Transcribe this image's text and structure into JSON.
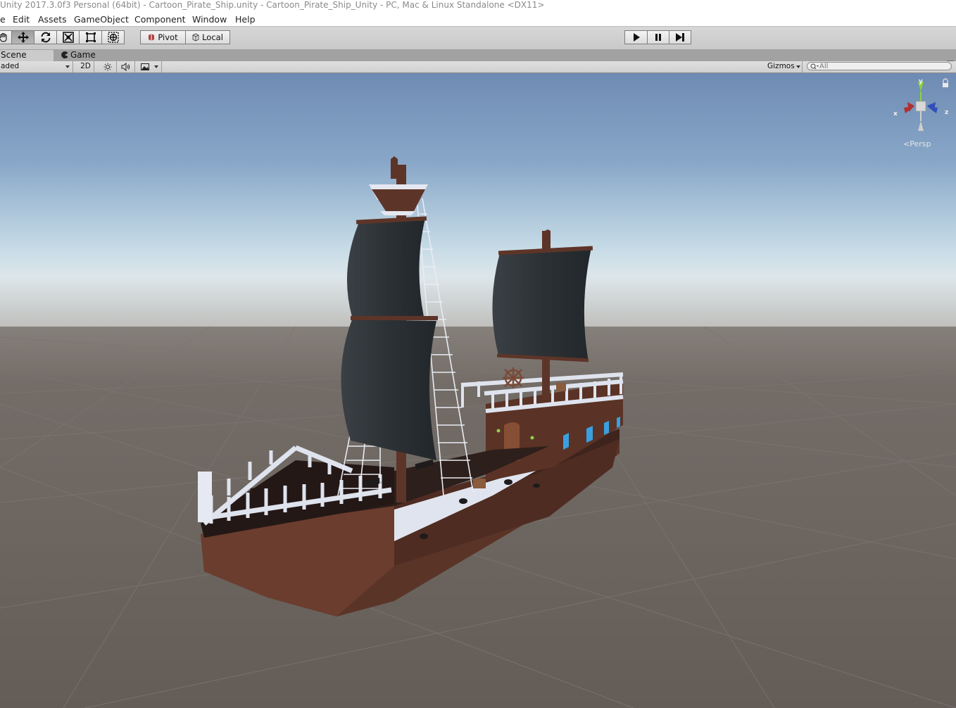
{
  "window": {
    "title": "Unity 2017.3.0f3 Personal (64bit) - Cartoon_Pirate_Ship.unity - Cartoon_Pirate_Ship_Unity - PC, Mac & Linux Standalone <DX11>"
  },
  "menu": {
    "file": "e",
    "edit": "Edit",
    "assets": "Assets",
    "gameobject": "GameObject",
    "component": "Component",
    "window": "Window",
    "help": "Help"
  },
  "toolbar": {
    "tools": [
      "hand-icon",
      "move-icon",
      "rotate-icon",
      "scale-icon",
      "rect-icon",
      "transform-icon"
    ],
    "active_tool": "move-icon",
    "pivot_label": "Pivot",
    "local_label": "Local",
    "playback": [
      "play-icon",
      "pause-icon",
      "step-icon"
    ]
  },
  "tabs": {
    "scene": "Scene",
    "game": "Game"
  },
  "scene_toolbar": {
    "shading_mode": "aded",
    "mode_2d": "2D",
    "gizmos_label": "Gizmos",
    "search_placeholder": "All"
  },
  "viewport": {
    "projection_label": "Persp",
    "axis_labels": {
      "x": "x",
      "y": "y",
      "z": "z"
    },
    "colors": {
      "sky_top": "#6f8fb6",
      "horizon": "#cfe0ea",
      "ground": "#675f59",
      "hull": "#5b3428",
      "sails": "#2d3236",
      "rails": "#dfe3ee"
    }
  }
}
